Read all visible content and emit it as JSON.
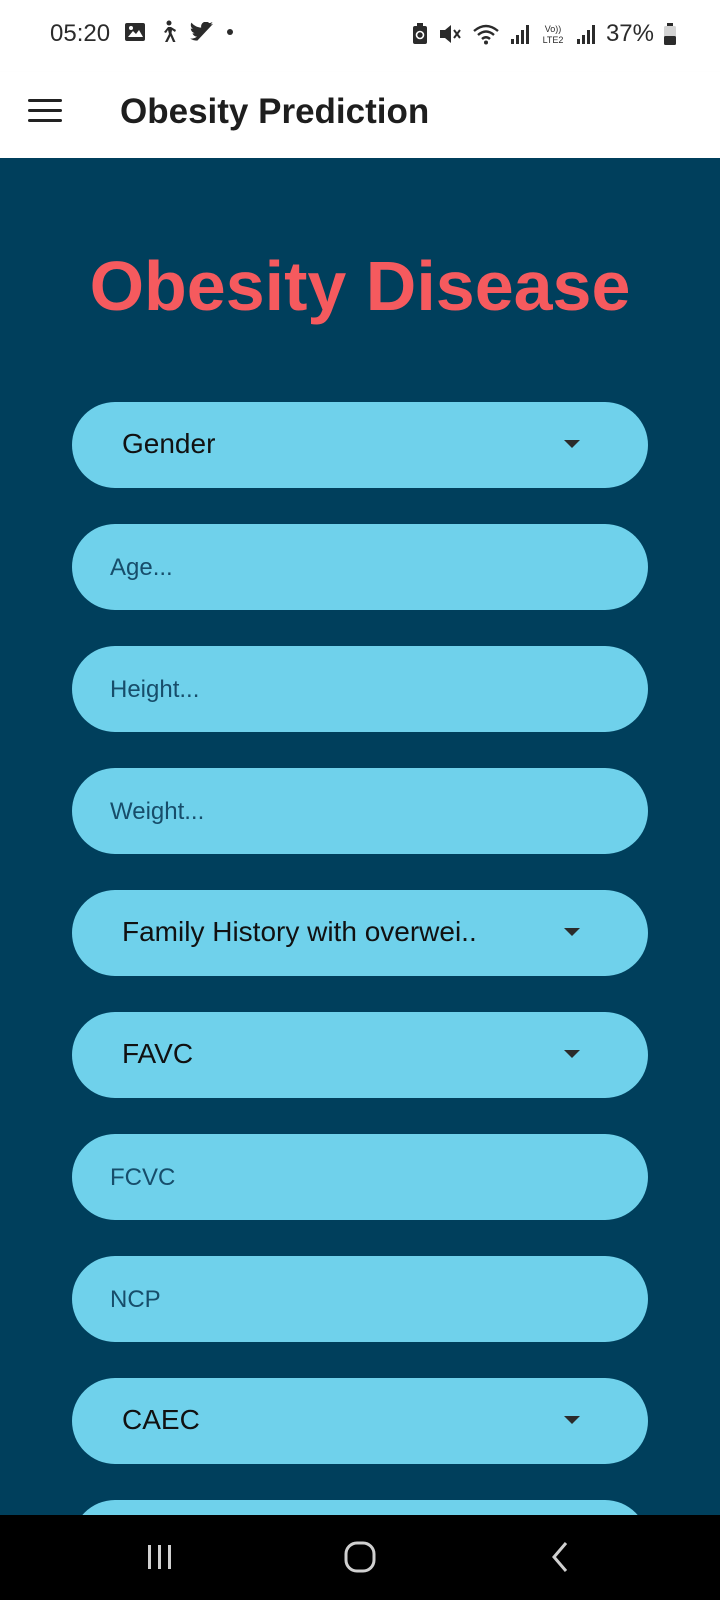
{
  "status_bar": {
    "time": "05:20",
    "battery": "37%",
    "icons": [
      "gallery-icon",
      "walking-icon",
      "twitter-icon",
      "dot-icon",
      "battery-saver-icon",
      "mute-icon",
      "wifi-icon",
      "signal-icon",
      "volte-icon",
      "signal-icon",
      "battery-icon"
    ],
    "volte_label": "Vo)) LTE2"
  },
  "app_bar": {
    "title": "Obesity Prediction",
    "menu_icon": "hamburger-menu-icon"
  },
  "main": {
    "heading": "Obesity Disease",
    "heading_color": "#f55a5e",
    "background_color": "#003f5c",
    "field_color": "#6fd1eb",
    "fields": {
      "gender": {
        "type": "dropdown",
        "label": "Gender"
      },
      "age": {
        "type": "input",
        "placeholder": "Age..."
      },
      "height": {
        "type": "input",
        "placeholder": "Height..."
      },
      "weight": {
        "type": "input",
        "placeholder": "Weight..."
      },
      "family_history": {
        "type": "dropdown",
        "label": "Family History with overwei.."
      },
      "favc": {
        "type": "dropdown",
        "label": "FAVC"
      },
      "fcvc": {
        "type": "input",
        "placeholder": "FCVC"
      },
      "ncp": {
        "type": "input",
        "placeholder": "NCP"
      },
      "caec": {
        "type": "dropdown",
        "label": "CAEC"
      }
    }
  },
  "nav_bar": {
    "buttons": [
      "recent-apps-icon",
      "home-icon",
      "back-icon"
    ]
  }
}
